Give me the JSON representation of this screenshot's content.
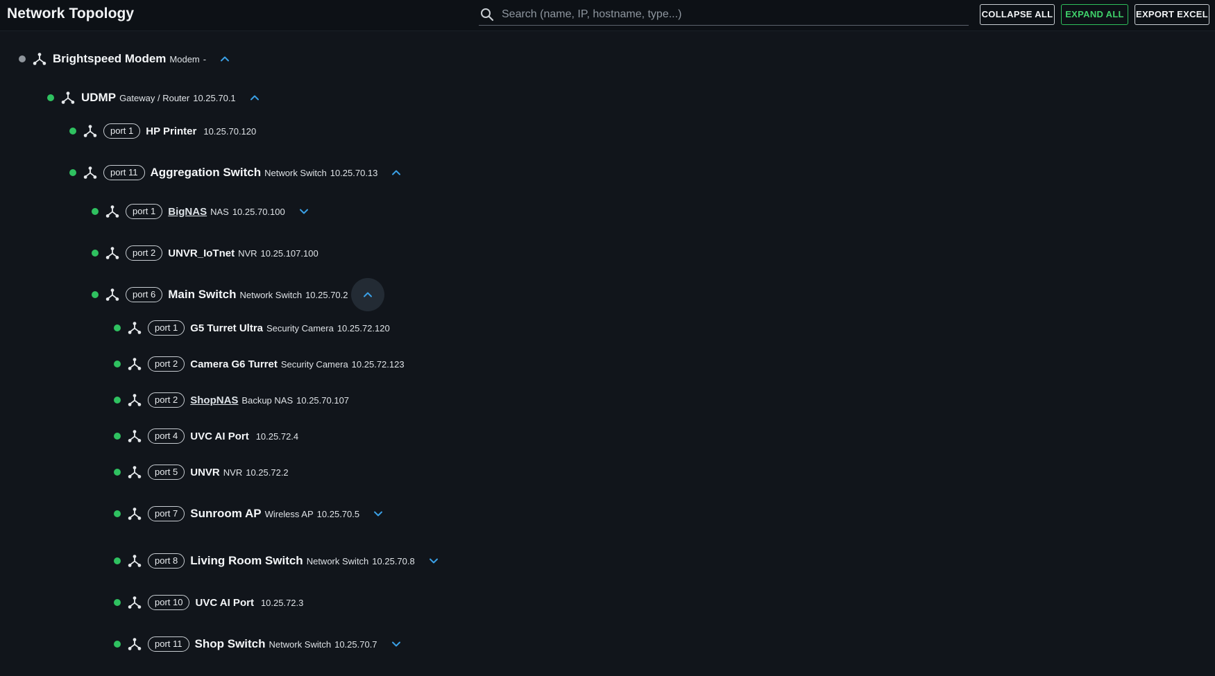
{
  "header": {
    "title": "Network Topology",
    "search_placeholder": "Search (name, IP, hostname, type...)",
    "collapse_label": "COLLAPSE ALL",
    "expand_label": "EXPAND ALL",
    "export_label": "EXPORT EXCEL"
  },
  "colors": {
    "online": "#2fc160",
    "unknown": "#8f959c",
    "accent_toggle": "#3aa0e6",
    "expand_button": "#3fd06a"
  },
  "tree": {
    "modem": {
      "name": "Brightspeed Modem",
      "type": "Modem",
      "ip": "-",
      "status": "unknown",
      "state": "expanded"
    },
    "udmp": {
      "name": "UDMP",
      "type": "Gateway / Router",
      "ip": "10.25.70.1",
      "status": "online",
      "state": "expanded"
    },
    "hp_printer": {
      "port": "port 1",
      "name": "HP Printer",
      "ip": "10.25.70.120",
      "status": "online"
    },
    "agg_switch": {
      "port": "port 11",
      "name": "Aggregation Switch",
      "type": "Network Switch",
      "ip": "10.25.70.13",
      "status": "online",
      "state": "expanded"
    },
    "bignas": {
      "port": "port 1",
      "name": "BigNAS",
      "type": "NAS",
      "ip": "10.25.70.100",
      "status": "online",
      "state": "collapsed"
    },
    "unvr_iotnet": {
      "port": "port 2",
      "name": "UNVR_IoTnet",
      "type": "NVR",
      "ip": "10.25.107.100",
      "status": "online"
    },
    "main_switch": {
      "port": "port 6",
      "name": "Main Switch",
      "type": "Network Switch",
      "ip": "10.25.70.2",
      "status": "online",
      "state": "expanded"
    },
    "g5_turret": {
      "port": "port 1",
      "name": "G5 Turret Ultra",
      "type": "Security Camera",
      "ip": "10.25.72.120",
      "status": "online"
    },
    "g6_turret": {
      "port": "port 2",
      "name": "Camera G6 Turret",
      "type": "Security Camera",
      "ip": "10.25.72.123",
      "status": "online"
    },
    "shopnas": {
      "port": "port 2",
      "name": "ShopNAS",
      "type": "Backup NAS",
      "ip": "10.25.70.107",
      "status": "online"
    },
    "uvc_ai_port_1": {
      "port": "port 4",
      "name": "UVC AI Port",
      "ip": "10.25.72.4",
      "status": "online"
    },
    "unvr": {
      "port": "port 5",
      "name": "UNVR",
      "type": "NVR",
      "ip": "10.25.72.2",
      "status": "online"
    },
    "sunroom_ap": {
      "port": "port 7",
      "name": "Sunroom AP",
      "type": "Wireless AP",
      "ip": "10.25.70.5",
      "status": "online",
      "state": "collapsed"
    },
    "living_room_switch": {
      "port": "port 8",
      "name": "Living Room Switch",
      "type": "Network Switch",
      "ip": "10.25.70.8",
      "status": "online",
      "state": "collapsed"
    },
    "uvc_ai_port_2": {
      "port": "port 10",
      "name": "UVC AI Port",
      "ip": "10.25.72.3",
      "status": "online"
    },
    "shop_switch": {
      "port": "port 11",
      "name": "Shop Switch",
      "type": "Network Switch",
      "ip": "10.25.70.7",
      "status": "online",
      "state": "collapsed"
    }
  },
  "icons": {
    "search": "search-icon",
    "node": "network-node-icon",
    "expanded": "chevron-up-icon",
    "collapsed": "chevron-down-icon"
  }
}
